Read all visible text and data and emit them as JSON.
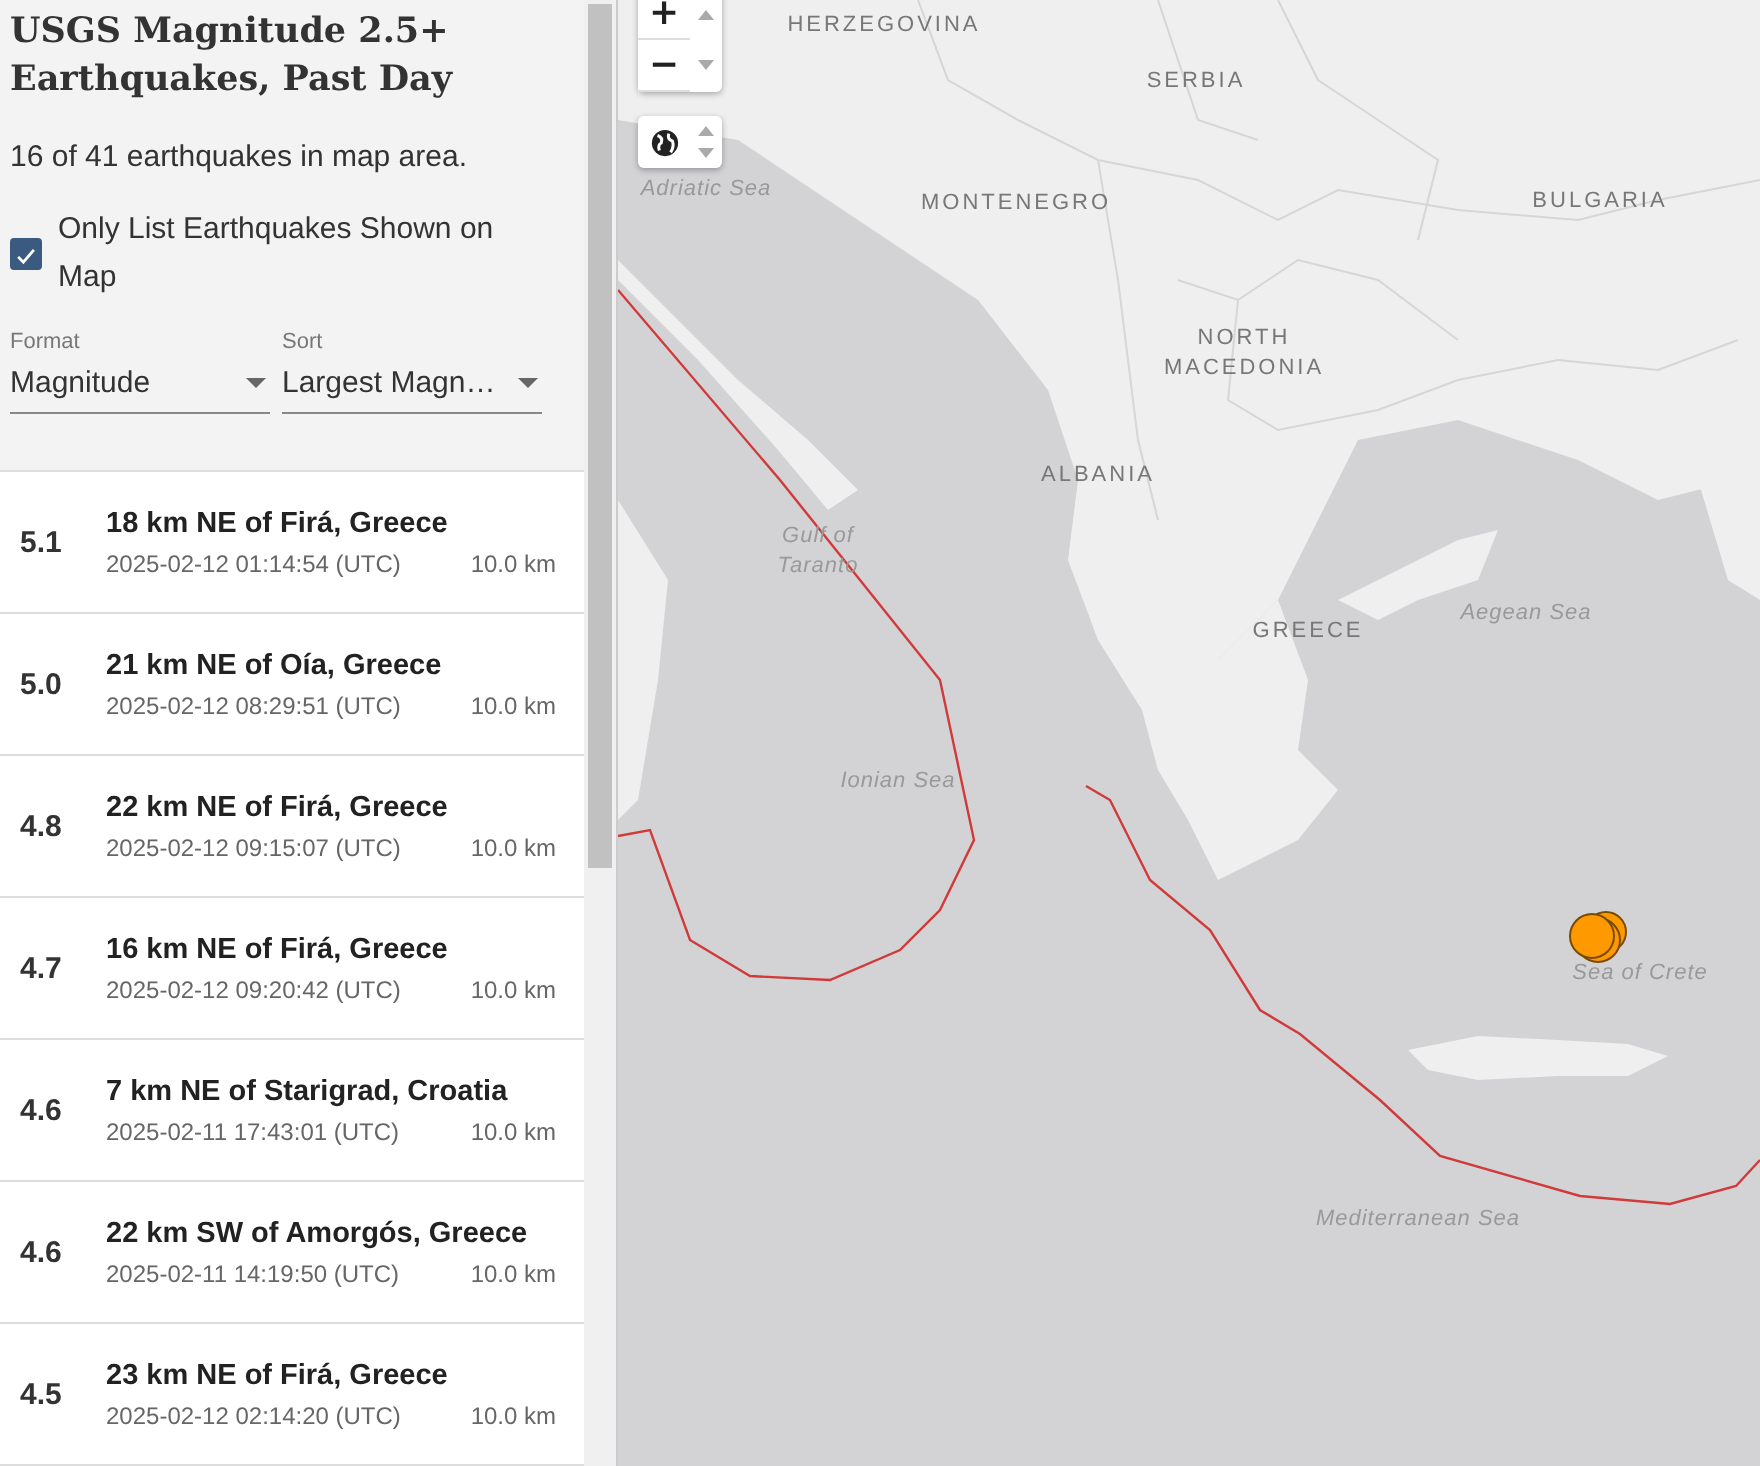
{
  "sidebar": {
    "title": "USGS Magnitude 2.5+ Earthquakes, Past Day",
    "summary": "16 of 41 earthquakes in map area.",
    "only_list_shown": {
      "label": "Only List Earthquakes Shown on Map",
      "checked": true
    },
    "selects": [
      {
        "label": "Format",
        "value": "Magnitude"
      },
      {
        "label": "Sort",
        "value": "Largest Magn…"
      }
    ]
  },
  "earthquakes": [
    {
      "magnitude": "5.1",
      "place": "18 km NE of Firá, Greece",
      "time": "2025-02-12 01:14:54 (UTC)",
      "depth": "10.0 km"
    },
    {
      "magnitude": "5.0",
      "place": "21 km NE of Oía, Greece",
      "time": "2025-02-12 08:29:51 (UTC)",
      "depth": "10.0 km"
    },
    {
      "magnitude": "4.8",
      "place": "22 km NE of Firá, Greece",
      "time": "2025-02-12 09:15:07 (UTC)",
      "depth": "10.0 km"
    },
    {
      "magnitude": "4.7",
      "place": "16 km NE of Firá, Greece",
      "time": "2025-02-12 09:20:42 (UTC)",
      "depth": "10.0 km"
    },
    {
      "magnitude": "4.6",
      "place": "7 km NE of Starigrad, Croatia",
      "time": "2025-02-11 17:43:01 (UTC)",
      "depth": "10.0 km"
    },
    {
      "magnitude": "4.6",
      "place": "22 km SW of Amorgós, Greece",
      "time": "2025-02-11 14:19:50 (UTC)",
      "depth": "10.0 km"
    },
    {
      "magnitude": "4.5",
      "place": "23 km NE of Firá, Greece",
      "time": "2025-02-12 02:14:20 (UTC)",
      "depth": "10.0 km"
    }
  ],
  "map": {
    "zoom_in": "+",
    "zoom_out": "−",
    "labels": [
      {
        "text": "HERZEGOVINA",
        "kind": "country"
      },
      {
        "text": "SERBIA",
        "kind": "country"
      },
      {
        "text": "Adriatic Sea",
        "kind": "sea"
      },
      {
        "text": "MONTENEGRO",
        "kind": "country"
      },
      {
        "text": "BULGARIA",
        "kind": "country"
      },
      {
        "text": "NORTH MACEDONIA",
        "kind": "country"
      },
      {
        "text": "ALBANIA",
        "kind": "country"
      },
      {
        "text": "Gulf of Taranto",
        "kind": "sea"
      },
      {
        "text": "GREECE",
        "kind": "country"
      },
      {
        "text": "Aegean Sea",
        "kind": "sea"
      },
      {
        "text": "Ionian Sea",
        "kind": "sea"
      },
      {
        "text": "Sea of Crete",
        "kind": "sea"
      },
      {
        "text": "Mediterranean Sea",
        "kind": "sea"
      }
    ]
  }
}
